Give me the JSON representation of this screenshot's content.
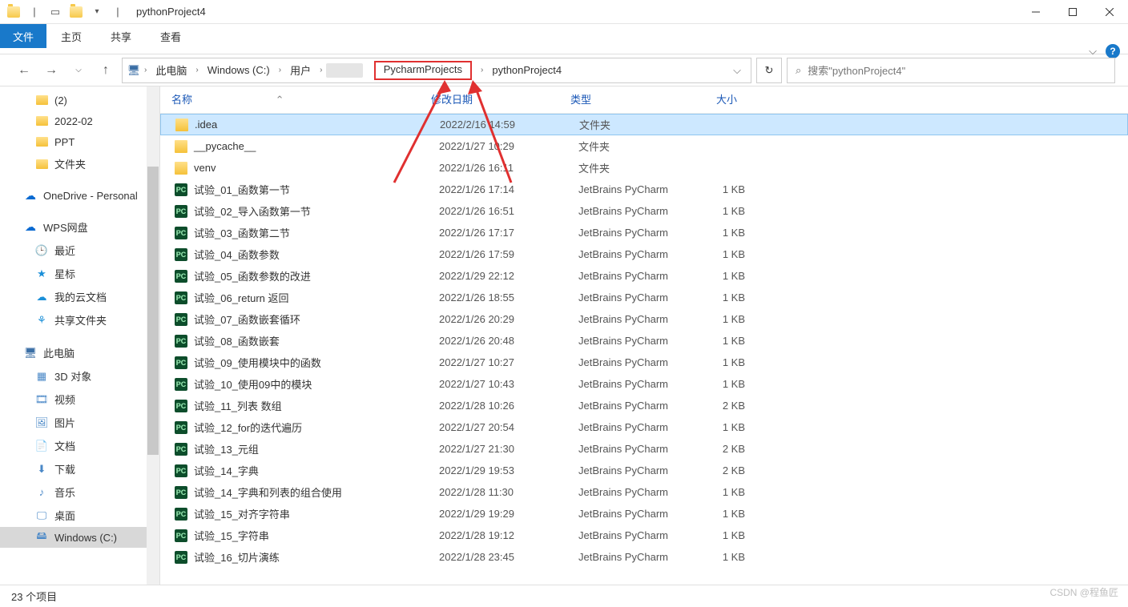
{
  "window": {
    "title": "pythonProject4"
  },
  "tabs": {
    "file": "文件",
    "home": "主页",
    "share": "共享",
    "view": "查看"
  },
  "breadcrumb": {
    "root_icon": "pc",
    "items": [
      "此电脑",
      "Windows (C:)",
      "用户",
      "",
      "PycharmProjects",
      "pythonProject4"
    ],
    "highlighted": "PycharmProjects"
  },
  "search": {
    "placeholder": "搜索\"pythonProject4\""
  },
  "columns": {
    "name": "名称",
    "date": "修改日期",
    "type": "类型",
    "size": "大小"
  },
  "sidebar": {
    "quick": [
      {
        "label": "(2)",
        "icon": "folder"
      },
      {
        "label": "2022-02",
        "icon": "folder"
      },
      {
        "label": "PPT",
        "icon": "folder"
      },
      {
        "label": "文件夹",
        "icon": "folder"
      }
    ],
    "onedrive": {
      "label": "OneDrive - Personal"
    },
    "wps": {
      "label": "WPS网盘",
      "children": [
        {
          "label": "最近",
          "icon": "clock"
        },
        {
          "label": "星标",
          "icon": "star"
        },
        {
          "label": "我的云文档",
          "icon": "cloud"
        },
        {
          "label": "共享文件夹",
          "icon": "share"
        }
      ]
    },
    "thispc": {
      "label": "此电脑",
      "children": [
        {
          "label": "3D 对象",
          "icon": "3d"
        },
        {
          "label": "视频",
          "icon": "video"
        },
        {
          "label": "图片",
          "icon": "pictures"
        },
        {
          "label": "文档",
          "icon": "docs"
        },
        {
          "label": "下载",
          "icon": "downloads"
        },
        {
          "label": "音乐",
          "icon": "music"
        },
        {
          "label": "桌面",
          "icon": "desktop"
        },
        {
          "label": "Windows (C:)",
          "icon": "drive",
          "selected": true
        }
      ]
    }
  },
  "files": [
    {
      "name": ".idea",
      "date": "2022/2/16 14:59",
      "type": "文件夹",
      "size": "",
      "icon": "folder",
      "selected": true
    },
    {
      "name": "__pycache__",
      "date": "2022/1/27 10:29",
      "type": "文件夹",
      "size": "",
      "icon": "folder"
    },
    {
      "name": "venv",
      "date": "2022/1/26 16:11",
      "type": "文件夹",
      "size": "",
      "icon": "folder"
    },
    {
      "name": "试验_01_函数第一节",
      "date": "2022/1/26 17:14",
      "type": "JetBrains PyCharm",
      "size": "1 KB",
      "icon": "pc"
    },
    {
      "name": "试验_02_导入函数第一节",
      "date": "2022/1/26 16:51",
      "type": "JetBrains PyCharm",
      "size": "1 KB",
      "icon": "pc"
    },
    {
      "name": "试验_03_函数第二节",
      "date": "2022/1/26 17:17",
      "type": "JetBrains PyCharm",
      "size": "1 KB",
      "icon": "pc"
    },
    {
      "name": "试验_04_函数参数",
      "date": "2022/1/26 17:59",
      "type": "JetBrains PyCharm",
      "size": "1 KB",
      "icon": "pc"
    },
    {
      "name": "试验_05_函数参数的改进",
      "date": "2022/1/29 22:12",
      "type": "JetBrains PyCharm",
      "size": "1 KB",
      "icon": "pc"
    },
    {
      "name": "试验_06_return 返回",
      "date": "2022/1/26 18:55",
      "type": "JetBrains PyCharm",
      "size": "1 KB",
      "icon": "pc"
    },
    {
      "name": "试验_07_函数嵌套循环",
      "date": "2022/1/26 20:29",
      "type": "JetBrains PyCharm",
      "size": "1 KB",
      "icon": "pc"
    },
    {
      "name": "试验_08_函数嵌套",
      "date": "2022/1/26 20:48",
      "type": "JetBrains PyCharm",
      "size": "1 KB",
      "icon": "pc"
    },
    {
      "name": "试验_09_使用模块中的函数",
      "date": "2022/1/27 10:27",
      "type": "JetBrains PyCharm",
      "size": "1 KB",
      "icon": "pc"
    },
    {
      "name": "试验_10_使用09中的模块",
      "date": "2022/1/27 10:43",
      "type": "JetBrains PyCharm",
      "size": "1 KB",
      "icon": "pc"
    },
    {
      "name": "试验_11_列表 数组",
      "date": "2022/1/28 10:26",
      "type": "JetBrains PyCharm",
      "size": "2 KB",
      "icon": "pc"
    },
    {
      "name": "试验_12_for的迭代遍历",
      "date": "2022/1/27 20:54",
      "type": "JetBrains PyCharm",
      "size": "1 KB",
      "icon": "pc"
    },
    {
      "name": "试验_13_元组",
      "date": "2022/1/27 21:30",
      "type": "JetBrains PyCharm",
      "size": "2 KB",
      "icon": "pc"
    },
    {
      "name": "试验_14_字典",
      "date": "2022/1/29 19:53",
      "type": "JetBrains PyCharm",
      "size": "2 KB",
      "icon": "pc"
    },
    {
      "name": "试验_14_字典和列表的组合使用",
      "date": "2022/1/28 11:30",
      "type": "JetBrains PyCharm",
      "size": "1 KB",
      "icon": "pc"
    },
    {
      "name": "试验_15_对齐字符串",
      "date": "2022/1/29 19:29",
      "type": "JetBrains PyCharm",
      "size": "1 KB",
      "icon": "pc"
    },
    {
      "name": "试验_15_字符串",
      "date": "2022/1/28 19:12",
      "type": "JetBrains PyCharm",
      "size": "1 KB",
      "icon": "pc"
    },
    {
      "name": "试验_16_切片演练",
      "date": "2022/1/28 23:45",
      "type": "JetBrains PyCharm",
      "size": "1 KB",
      "icon": "pc"
    }
  ],
  "status": {
    "items": "23 个项目"
  },
  "watermark": "CSDN @程鱼匠"
}
